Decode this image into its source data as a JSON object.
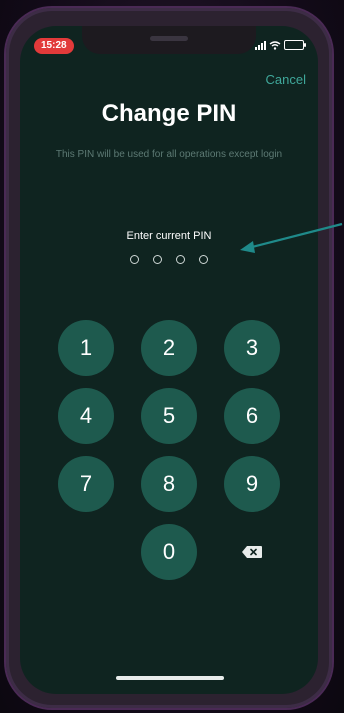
{
  "status_bar": {
    "time": "15:28"
  },
  "header": {
    "cancel_label": "Cancel",
    "title": "Change PIN",
    "subtitle": "This PIN will be used for all operations except login"
  },
  "pin_entry": {
    "prompt": "Enter current PIN",
    "digit_count": 4,
    "filled": 0
  },
  "keypad": {
    "keys": [
      "1",
      "2",
      "3",
      "4",
      "5",
      "6",
      "7",
      "8",
      "9",
      "0"
    ],
    "backspace_icon": "backspace-icon"
  },
  "colors": {
    "background": "#0f2420",
    "key": "#1e5a4e",
    "accent": "#3fa79a",
    "annotation_arrow": "#1f8a8a"
  }
}
